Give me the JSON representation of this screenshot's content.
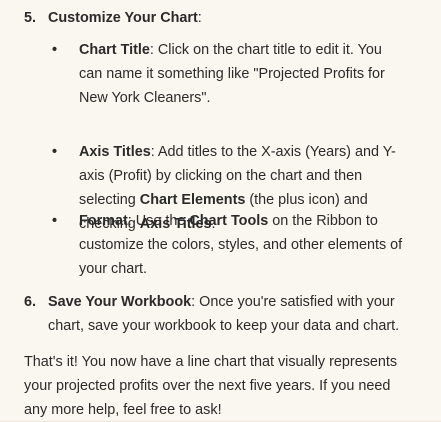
{
  "step5": {
    "number": "5.",
    "title": "Customize Your Chart",
    "suffix": ":",
    "bullets": [
      {
        "bullet": "•",
        "lines": [
          [
            {
              "b": "Chart Title"
            },
            {
              "t": ": Click on the chart title to edit it. You"
            }
          ],
          [
            {
              "t": "can name it something like \"Projected Profits for"
            }
          ],
          [
            {
              "t": "New York Cleaners\"."
            }
          ]
        ]
      },
      {
        "bullet": "•",
        "lines": [
          [
            {
              "b": "Axis Titles"
            },
            {
              "t": ": Add titles to the X-axis (Years) and Y-"
            }
          ],
          [
            {
              "t": "axis (Profit) by clicking on the chart and then"
            }
          ],
          [
            {
              "t": "selecting "
            },
            {
              "b": "Chart Elements"
            },
            {
              "t": " (the plus icon) and"
            }
          ],
          [
            {
              "t": "checking "
            },
            {
              "b": "Axis Titles"
            },
            {
              "t": "."
            }
          ]
        ]
      },
      {
        "bullet": "•",
        "lines": [
          [
            {
              "b": "Format"
            },
            {
              "t": ": Use the "
            },
            {
              "b": "Chart Tools"
            },
            {
              "t": " on the Ribbon to"
            }
          ],
          [
            {
              "t": "customize the colors, styles, and other elements of"
            }
          ],
          [
            {
              "t": "your chart."
            }
          ]
        ]
      }
    ]
  },
  "step6": {
    "number": "6.",
    "lines": [
      [
        {
          "b": "Save Your Workbook"
        },
        {
          "t": ": Once you're satisfied with your"
        }
      ],
      [
        {
          "t": "chart, save your workbook to keep your data and chart."
        }
      ]
    ]
  },
  "closing": {
    "lines": [
      "That's it! You now have a line chart that visually represents",
      "your projected profits over the next five years. If you need",
      "any more help, feel free to ask!"
    ]
  }
}
